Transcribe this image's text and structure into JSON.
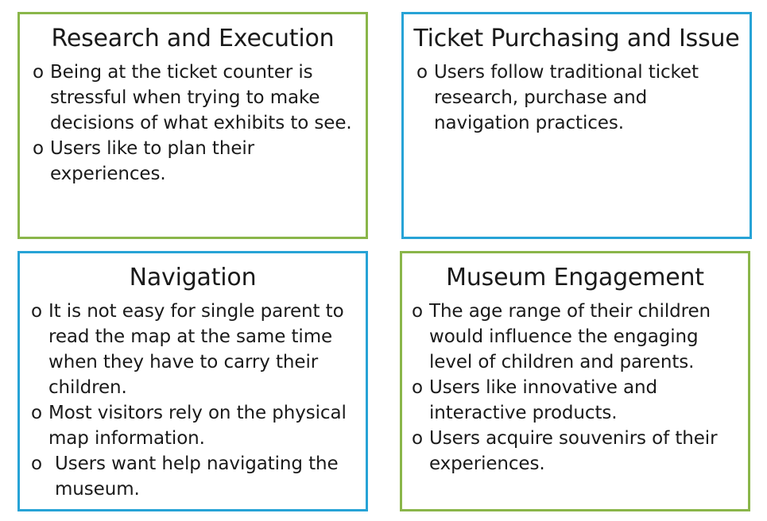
{
  "cards": [
    {
      "title": "Research and Execution",
      "items": [
        "Being at the ticket counter is stressful when trying to make decisions of what exhibits to see.",
        "Users like to plan their experiences."
      ]
    },
    {
      "title": "Ticket Purchasing and Issue",
      "items": [
        "Users follow traditional ticket research, purchase and navigation practices."
      ]
    },
    {
      "title": "Navigation",
      "items": [
        "It is not easy for single parent to read the map at the same time when they have to carry their children.",
        "Most visitors rely on the physical map information.",
        "Users want help navigating the museum."
      ]
    },
    {
      "title": "Museum Engagement",
      "items": [
        "The age range of their children would influence the engaging level of children and parents.",
        "Users like innovative and interactive products.",
        "Users acquire souvenirs of their experiences."
      ]
    }
  ],
  "bullet_symbol": "o",
  "colors": {
    "green_border": "#8ab64a",
    "blue_border": "#27a3d6"
  }
}
